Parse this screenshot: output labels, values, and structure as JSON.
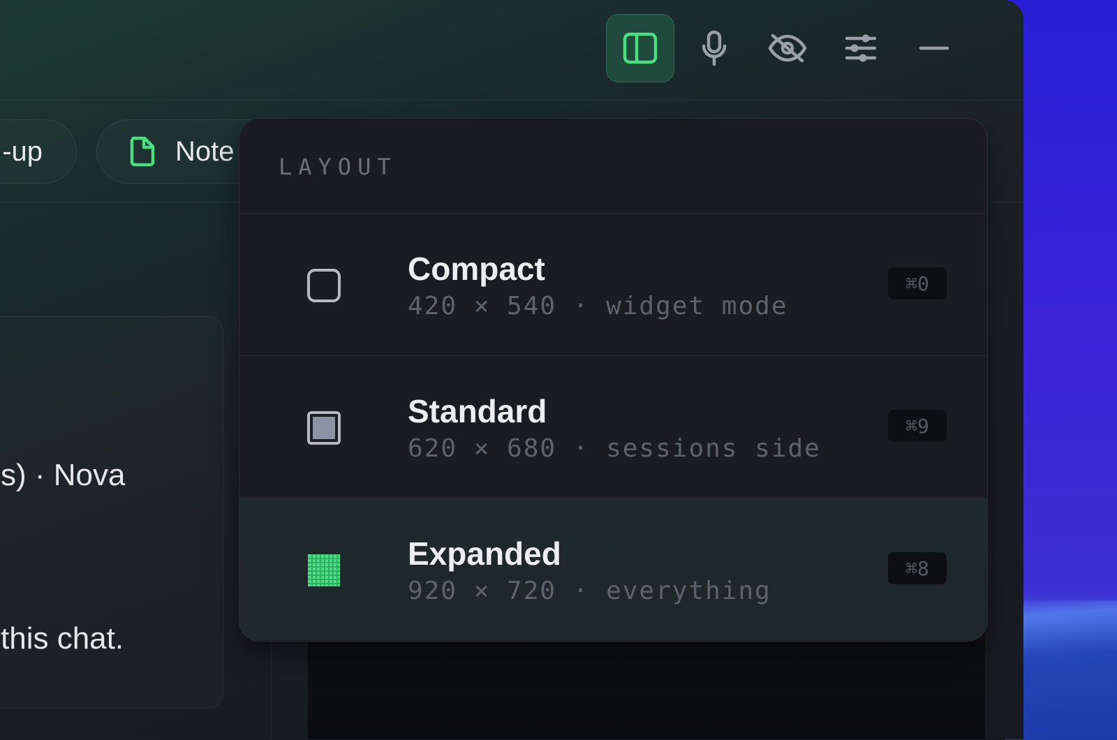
{
  "titlebar": {
    "buttons": [
      {
        "name": "layout-toggle",
        "icon": "sidebar-panel-icon",
        "active": true
      },
      {
        "name": "microphone",
        "icon": "microphone-icon"
      },
      {
        "name": "hide",
        "icon": "eye-off-icon"
      },
      {
        "name": "settings",
        "icon": "sliders-icon"
      },
      {
        "name": "minimize",
        "icon": "minus-icon"
      }
    ],
    "accent": "#4ade80"
  },
  "toolbar": {
    "pill_1_label": "-up",
    "pill_2_label": "Note",
    "pill_2_icon": "file-icon"
  },
  "card": {
    "line_1": "s)  ·  Nova",
    "line_2": "this chat."
  },
  "layout_menu": {
    "title": "LAYOUT",
    "items": [
      {
        "name": "Compact",
        "detail": "420 × 540 · widget mode",
        "shortcut": "⌘0",
        "icon": "square-outline-icon",
        "selected": false
      },
      {
        "name": "Standard",
        "detail": "620 × 680 · sessions side",
        "shortcut": "⌘9",
        "icon": "square-filled-icon",
        "selected": false
      },
      {
        "name": "Expanded",
        "detail": "920 × 720 · everything",
        "shortcut": "⌘8",
        "icon": "grid-icon",
        "selected": true
      }
    ]
  }
}
